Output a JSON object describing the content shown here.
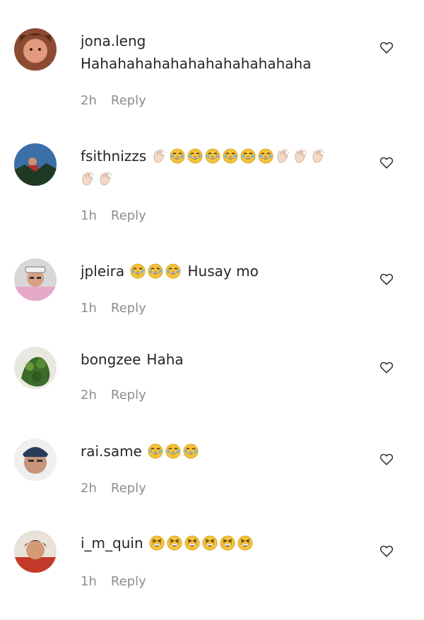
{
  "comments": [
    {
      "user": "jona.leng",
      "text": "Hahahahahahahahahahahahaha",
      "time": "2h",
      "reply": "Reply"
    },
    {
      "user": "fsithnizzs",
      "text": "",
      "time": "1h",
      "reply": "Reply"
    },
    {
      "user": "jpleira",
      "text": "Husay mo",
      "time": "1h",
      "reply": "Reply"
    },
    {
      "user": "bongzee",
      "text": "Haha",
      "time": "2h",
      "reply": "Reply"
    },
    {
      "user": "rai.same",
      "text": "",
      "time": "2h",
      "reply": "Reply"
    },
    {
      "user": "i_m_quin",
      "text": "",
      "time": "1h",
      "reply": "Reply"
    }
  ],
  "icons": {
    "like": "heart-outline-icon",
    "laugh": "face-with-tears-of-joy-emoji",
    "grin": "grinning-squinting-face-emoji",
    "clap": "clapping-hands-emoji"
  },
  "colors": {
    "text": "#262626",
    "muted": "#8e8e8e",
    "emoji": "#f5c33b"
  }
}
